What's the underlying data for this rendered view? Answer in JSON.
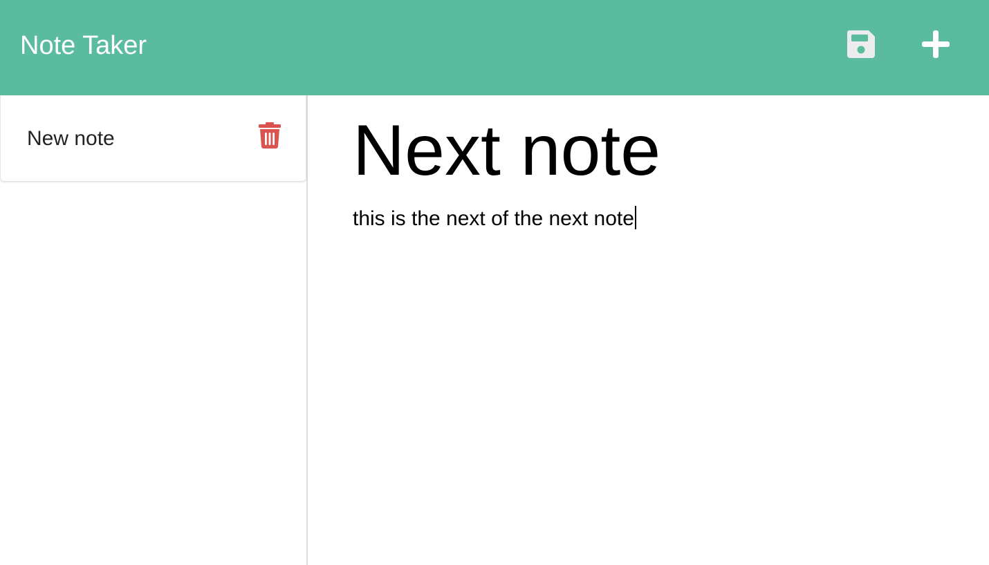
{
  "navbar": {
    "brand": "Note Taker",
    "save_icon": "floppy-disk-icon",
    "new_icon": "plus-icon",
    "background": "#5abb9f",
    "icon_color": "#ffffff"
  },
  "sidebar": {
    "notes": [
      {
        "title": "New note",
        "delete_icon": "trash-icon",
        "delete_color": "#d9534f"
      }
    ]
  },
  "editor": {
    "title": "Next note",
    "text": "this is the next of the next note"
  }
}
